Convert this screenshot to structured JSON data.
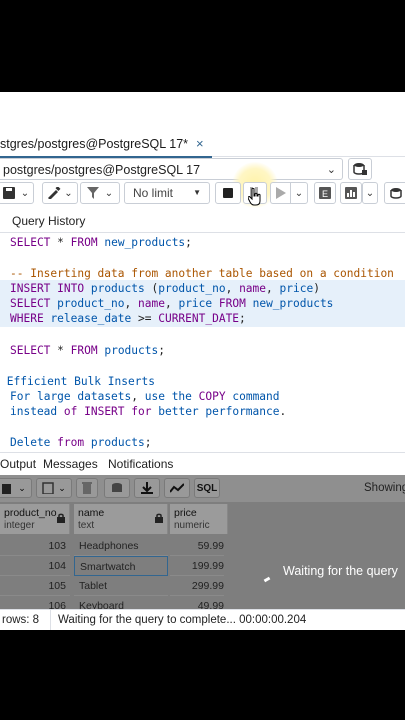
{
  "tab": {
    "title": "stgres/postgres@PostgreSQL 17*",
    "close": "×"
  },
  "connection": {
    "value": "postgres/postgres@PostgreSQL 17"
  },
  "toolbar": {
    "limit": "No limit"
  },
  "query_history_label": "Query History",
  "editor": {
    "lines": [
      {
        "kind": "sql1",
        "text": ""
      },
      {
        "kind": "comment",
        "text": "-- Inserting data from another table based on a condition"
      },
      {
        "kind": "insert",
        "text": ""
      },
      {
        "kind": "select2",
        "text": ""
      },
      {
        "kind": "where",
        "text": ""
      },
      {
        "kind": "select3",
        "text": ""
      },
      {
        "kind": "c1",
        "text": "Efficient Bulk Inserts"
      },
      {
        "kind": "c2",
        "text": ""
      },
      {
        "kind": "c3",
        "text": ""
      },
      {
        "kind": "del",
        "text": ""
      }
    ]
  },
  "results_tabs": [
    "Output",
    "Messages",
    "Notifications"
  ],
  "grid": {
    "showing": "Showing",
    "columns": [
      {
        "name": "product_no",
        "type": "integer"
      },
      {
        "name": "name",
        "type": "text"
      },
      {
        "name": "price",
        "type": "numeric"
      }
    ],
    "rows": [
      {
        "product_no": "103",
        "name": "Headphones",
        "price": "59.99"
      },
      {
        "product_no": "104",
        "name": "Smartwatch",
        "price": "199.99"
      },
      {
        "product_no": "105",
        "name": "Tablet",
        "price": "299.99"
      },
      {
        "product_no": "106",
        "name": "Keyboard",
        "price": "49.99"
      }
    ],
    "waiting": "Waiting for the query"
  },
  "status": {
    "rows": "rows: 8",
    "message": "Waiting for the query to complete... 00:00:00.204"
  },
  "colors": {
    "accent": "#326690",
    "keyword": "#770088",
    "identifier": "#0055aa",
    "comment": "#aa5500"
  }
}
